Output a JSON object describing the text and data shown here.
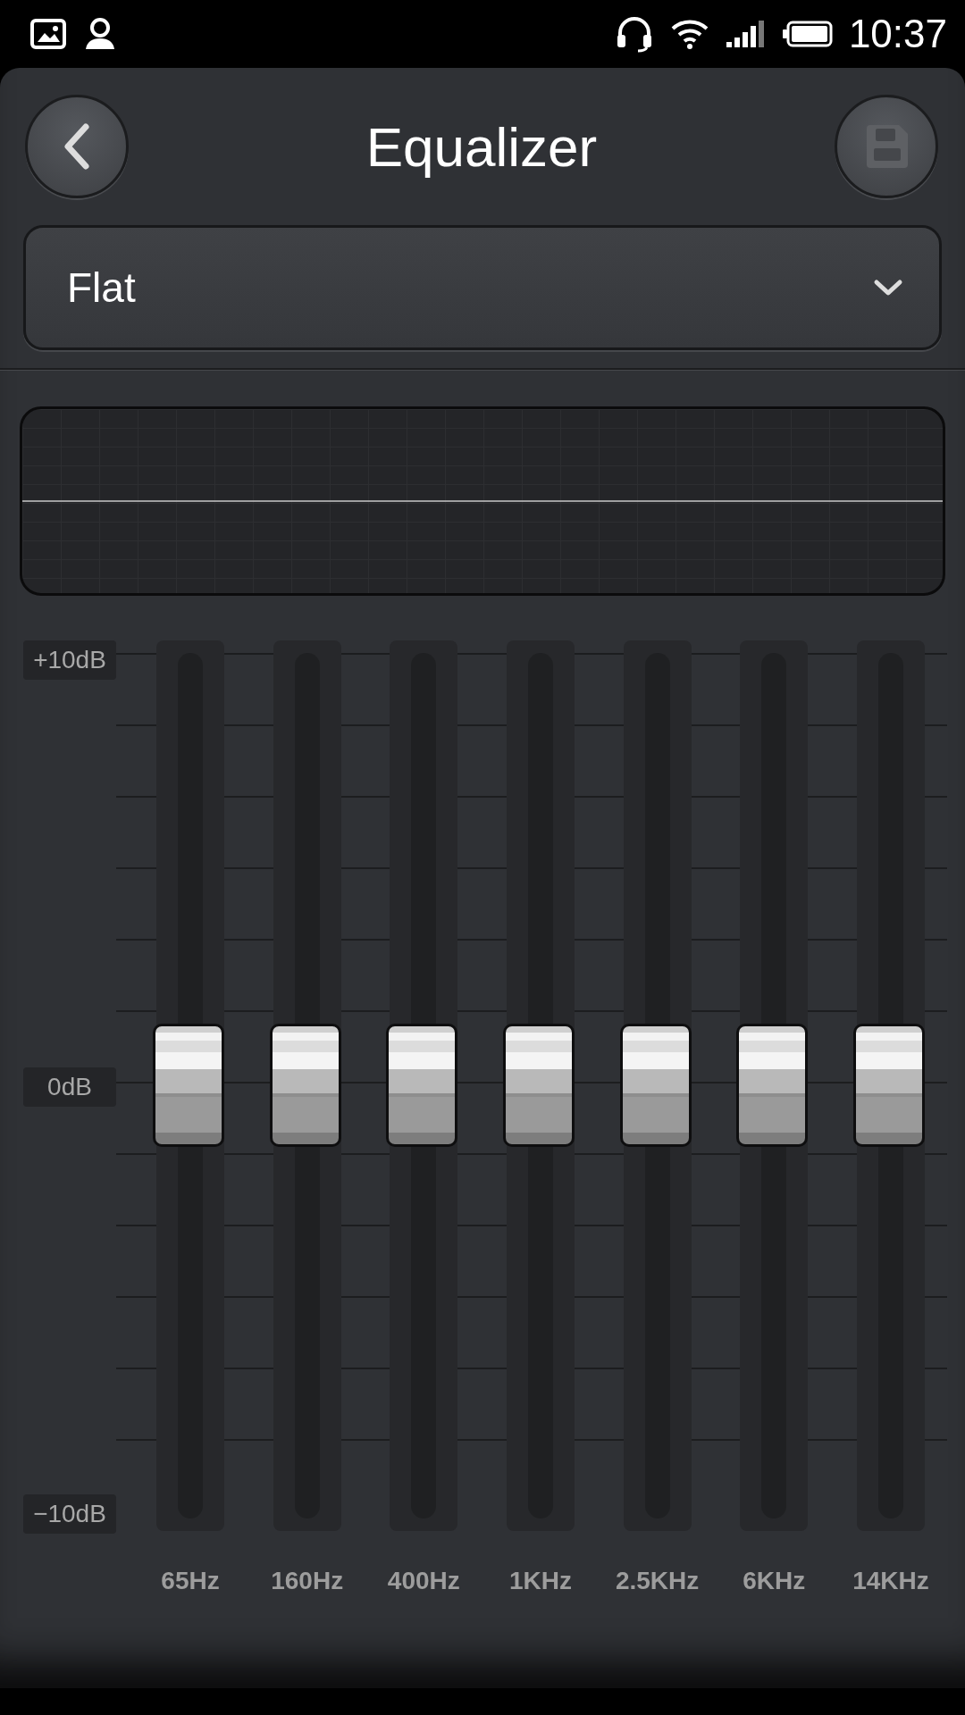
{
  "status_bar": {
    "time": "10:37"
  },
  "header": {
    "title": "Equalizer"
  },
  "preset": {
    "value": "Flat"
  },
  "scale": [
    "+10dB",
    "0dB",
    "−10dB"
  ],
  "bands": [
    {
      "label": "65Hz",
      "level": 0.5
    },
    {
      "label": "160Hz",
      "level": 0.5
    },
    {
      "label": "400Hz",
      "level": 0.5
    },
    {
      "label": "1KHz",
      "level": 0.5
    },
    {
      "label": "2.5KHz",
      "level": 0.5
    },
    {
      "label": "6KHz",
      "level": 0.5
    },
    {
      "label": "14KHz",
      "level": 0.5
    }
  ]
}
